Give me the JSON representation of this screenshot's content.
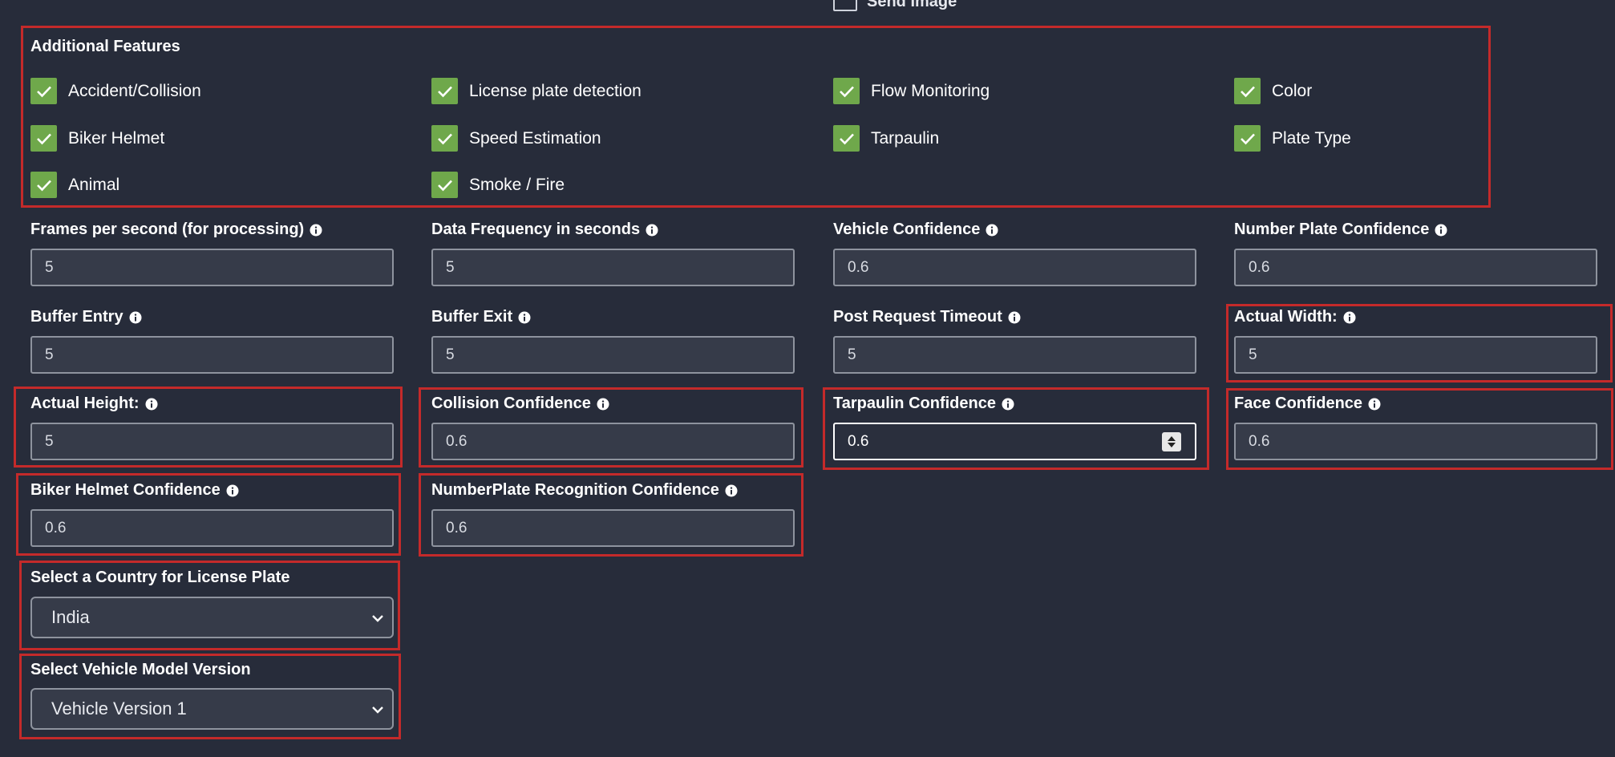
{
  "top_partial": {
    "label": "Send Image"
  },
  "additional_features": {
    "title": "Additional Features",
    "items": [
      {
        "label": "Accident/Collision"
      },
      {
        "label": "License plate detection"
      },
      {
        "label": "Flow Monitoring"
      },
      {
        "label": "Color"
      },
      {
        "label": "Biker Helmet"
      },
      {
        "label": "Speed Estimation"
      },
      {
        "label": "Tarpaulin"
      },
      {
        "label": "Plate Type"
      },
      {
        "label": "Animal"
      },
      {
        "label": "Smoke / Fire"
      }
    ]
  },
  "fields": {
    "fps": {
      "label": "Frames per second (for processing)",
      "value": "5"
    },
    "data_frequency": {
      "label": "Data Frequency in seconds",
      "value": "5"
    },
    "vehicle_confidence": {
      "label": "Vehicle Confidence",
      "value": "0.6"
    },
    "number_plate_confidence": {
      "label": "Number Plate Confidence",
      "value": "0.6"
    },
    "buffer_entry": {
      "label": "Buffer Entry",
      "value": "5"
    },
    "buffer_exit": {
      "label": "Buffer Exit",
      "value": "5"
    },
    "post_request_timeout": {
      "label": "Post Request Timeout",
      "value": "5"
    },
    "actual_width": {
      "label": "Actual Width:",
      "value": "5"
    },
    "actual_height": {
      "label": "Actual Height:",
      "value": "5"
    },
    "collision_confidence": {
      "label": "Collision Confidence",
      "value": "0.6"
    },
    "tarpaulin_confidence": {
      "label": "Tarpaulin Confidence",
      "value": "0.6"
    },
    "face_confidence": {
      "label": "Face Confidence",
      "value": "0.6"
    },
    "biker_helmet_confidence": {
      "label": "Biker Helmet Confidence",
      "value": "0.6"
    },
    "numberplate_recognition_confidence": {
      "label": "NumberPlate Recognition Confidence",
      "value": "0.6"
    }
  },
  "selects": {
    "country": {
      "label": "Select a Country for License Plate",
      "value": "India"
    },
    "vehicle_model": {
      "label": "Select Vehicle Model Version",
      "value": "Vehicle Version 1"
    }
  },
  "colors": {
    "background": "#272c3a",
    "checkbox_green": "#6fa84b",
    "highlight_red": "#c42a2a",
    "input_bg": "#363b49"
  }
}
